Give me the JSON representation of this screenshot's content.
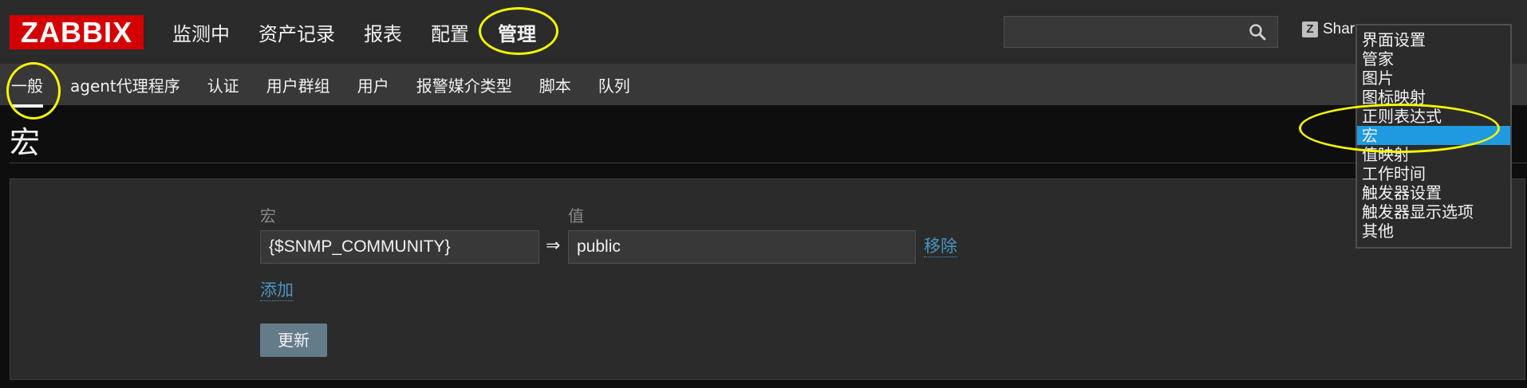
{
  "header": {
    "logo": "ZABBIX",
    "main_menu": [
      "监测中",
      "资产记录",
      "报表",
      "配置",
      "管理"
    ],
    "main_menu_selected": "管理",
    "search": {
      "value": "",
      "placeholder": ""
    },
    "share_label": "Share",
    "share_icon_letter": "Z"
  },
  "sub_menu": {
    "items": [
      "一般",
      "agent代理程序",
      "认证",
      "用户群组",
      "用户",
      "报警媒介类型",
      "脚本",
      "队列"
    ],
    "selected": "一般"
  },
  "page": {
    "title": "宏",
    "form": {
      "macro_label": "宏",
      "value_label": "值",
      "macro_value": "{$SNMP_COMMUNITY}",
      "arrow": "⇒",
      "value_value": "public",
      "remove_link": "移除",
      "add_link": "添加",
      "update_button": "更新"
    }
  },
  "dropdown": {
    "options": [
      "界面设置",
      "管家",
      "图片",
      "图标映射",
      "正则表达式",
      "宏",
      "值映射",
      "工作时间",
      "触发器设置",
      "触发器显示选项",
      "其他"
    ],
    "selected": "宏"
  },
  "colors": {
    "logo_bg": "#d40000",
    "link": "#4796c4",
    "dropdown_selected": "#1f9ae0",
    "highlight": "#f7f700",
    "button": "#647b8a"
  }
}
